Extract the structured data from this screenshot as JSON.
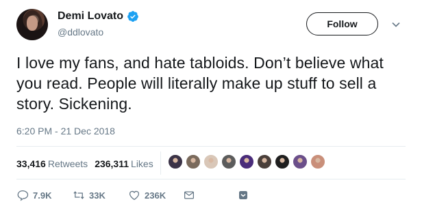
{
  "user": {
    "display_name": "Demi Lovato",
    "handle": "@ddlovato",
    "verified": true
  },
  "follow_label": "Follow",
  "tweet": {
    "text": "I love my fans, and hate tabloids. Don’t believe what you read. People will literally make up stuff to sell a story. Sickening.",
    "timestamp": "6:20 PM - 21 Dec 2018"
  },
  "stats": {
    "retweets_count": "33,416",
    "retweets_label": "Retweets",
    "likes_count": "236,311",
    "likes_label": "Likes"
  },
  "liker_avatar_colors": [
    "#3b3347",
    "#7a6a5c",
    "#d9c7b8",
    "#5c5c5c",
    "#4a2c7a",
    "#4a3f3a",
    "#1f1f1f",
    "#6b4f8a",
    "#c98f7a"
  ],
  "actions": {
    "replies": "7.9K",
    "retweets": "33K",
    "likes": "236K"
  },
  "colors": {
    "verified": "#1da1f2",
    "muted": "#657786",
    "text": "#14171a"
  }
}
